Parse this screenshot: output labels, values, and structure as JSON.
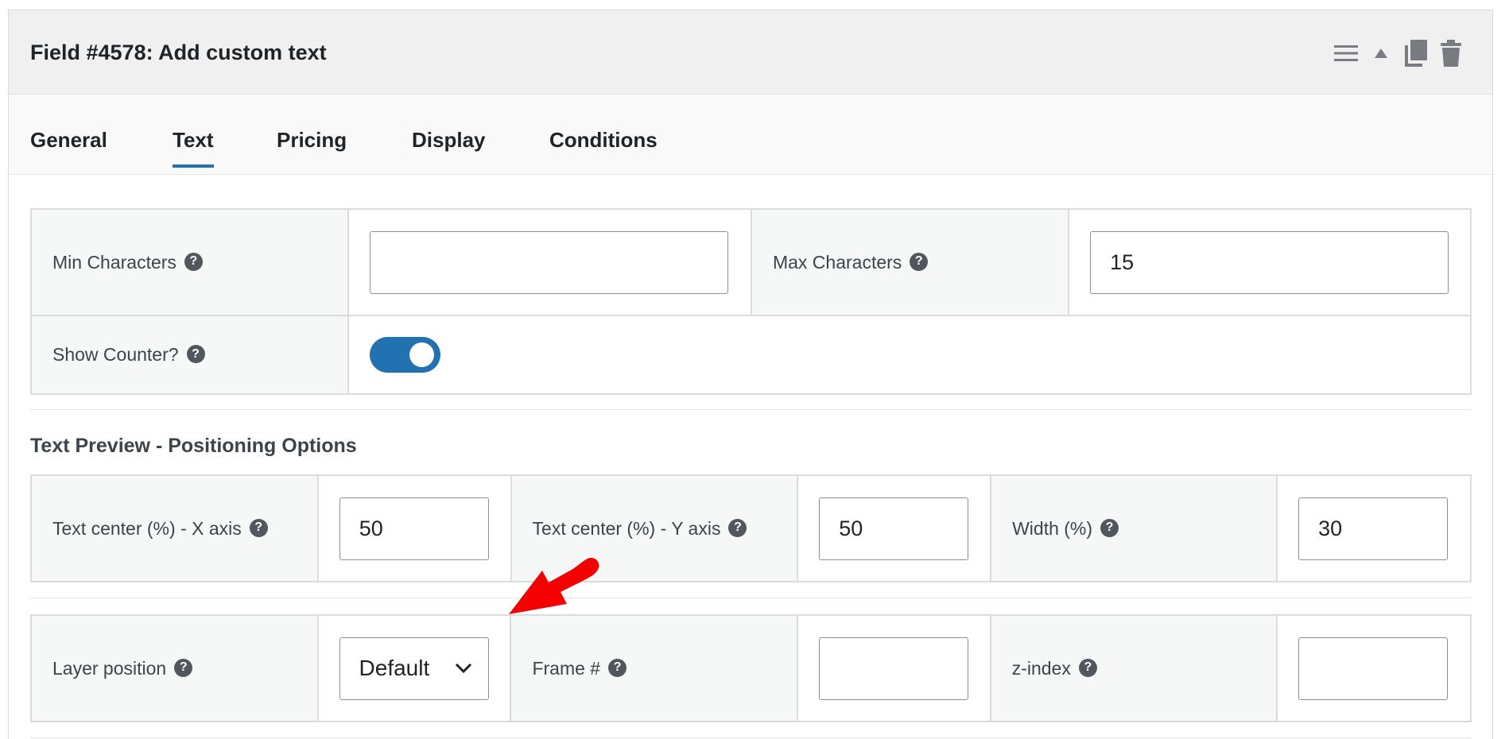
{
  "header": {
    "title": "Field #4578: Add custom text",
    "tools": [
      {
        "icon": "menu-icon",
        "label": "Menu"
      },
      {
        "icon": "collapse-triangle-icon",
        "label": "Collapse"
      },
      {
        "icon": "duplicate-icon",
        "label": "Duplicate"
      },
      {
        "icon": "trash-icon",
        "label": "Delete"
      }
    ]
  },
  "tabs": [
    {
      "label": "General",
      "active": false
    },
    {
      "label": "Text",
      "active": true
    },
    {
      "label": "Pricing",
      "active": false
    },
    {
      "label": "Display",
      "active": false
    },
    {
      "label": "Conditions",
      "active": false
    }
  ],
  "text_settings": {
    "min_characters": {
      "label": "Min Characters",
      "value": ""
    },
    "max_characters": {
      "label": "Max Characters",
      "value": "15"
    },
    "show_counter": {
      "label": "Show Counter?",
      "enabled": true
    }
  },
  "positioning": {
    "section_title": "Text Preview - Positioning Options",
    "x_axis": {
      "label": "Text center (%) - X axis",
      "value": "50"
    },
    "y_axis": {
      "label": "Text center (%) - Y axis",
      "value": "50"
    },
    "width": {
      "label": "Width (%)",
      "value": "30"
    },
    "layer_position": {
      "label": "Layer position",
      "value": "Default"
    },
    "frame": {
      "label": "Frame #",
      "value": ""
    },
    "z_index": {
      "label": "z-index",
      "value": ""
    }
  },
  "help_glyph": "?",
  "colors": {
    "accent": "#2271b1",
    "annotation_arrow": "#f50000"
  }
}
